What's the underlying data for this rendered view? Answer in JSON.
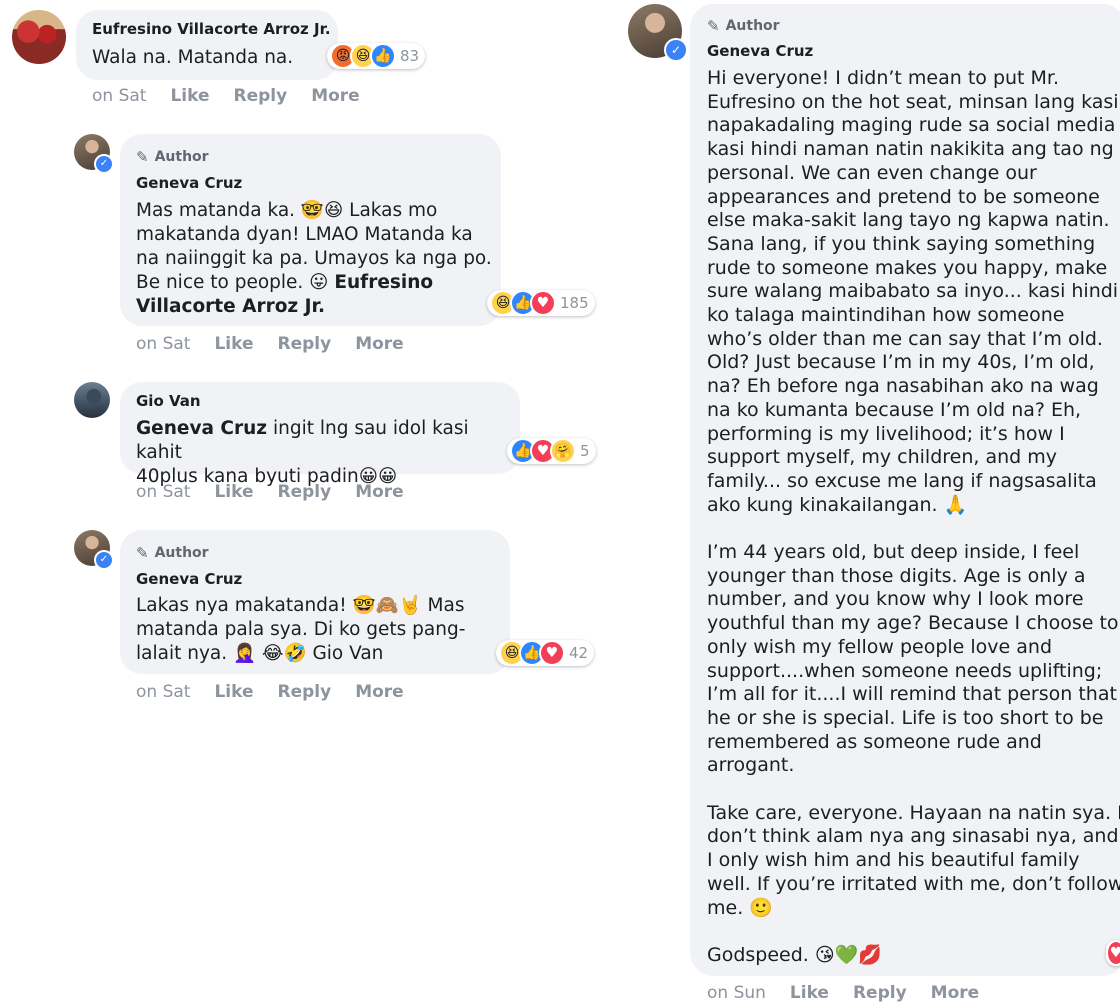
{
  "comments": [
    {
      "name": "Eufresino Villacorte Arroz Jr.",
      "text": "Wala na. Matanda na.",
      "reaction_count": "83",
      "actions": {
        "time": "on Sat",
        "like": "Like",
        "reply": "Reply",
        "more": "More"
      }
    },
    {
      "author_label": "Author",
      "name": "Geneva Cruz",
      "lines": [
        "Mas matanda ka. 🤓😆 Lakas mo",
        "makatanda dyan! LMAO Matanda ka",
        "na naiinggit ka pa. Umayos ka nga po.",
        "Be nice to people. 😛 "
      ],
      "mention_inline": "Eufresino",
      "mention_line2": "Villacorte Arroz Jr.",
      "reaction_count": "185",
      "actions": {
        "time": "on Sat",
        "like": "Like",
        "reply": "Reply",
        "more": "More"
      }
    },
    {
      "name": "Gio Van",
      "mention": "Geneva Cruz",
      "line1_rest": " ingit lng sau idol kasi kahit",
      "line2": "40plus kana byuti padin😀😀",
      "reaction_count": "5",
      "actions": {
        "time": "on Sat",
        "like": "Like",
        "reply": "Reply",
        "more": "More"
      }
    },
    {
      "author_label": "Author",
      "name": "Geneva Cruz",
      "lines": [
        "Lakas nya makatanda! 🤓🙈🤘 Mas",
        "matanda pala sya. Di ko gets pang-",
        "lalait nya. 🤦‍♀️ 😂🤣 Gio Van"
      ],
      "reaction_count": "42",
      "actions": {
        "time": "on Sat",
        "like": "Like",
        "reply": "Reply",
        "more": "More"
      }
    }
  ],
  "long_reply": {
    "author_label": "Author",
    "name": "Geneva Cruz",
    "paragraph1": [
      "Hi everyone! I didn’t mean to put Mr.",
      "Eufresino on the hot seat, minsan lang kasi",
      "napakadaling maging rude sa social media",
      "kasi hindi naman natin nakikita ang tao ng",
      "personal. We can even change our",
      "appearances and pretend to be someone",
      "else maka-sakit lang tayo ng kapwa natin.",
      "Sana lang, if you think saying something",
      "rude to someone makes you happy, make",
      "sure walang maibabato sa inyo... kasi hindi",
      "ko talaga maintindihan how someone",
      "who’s older than me can say that I’m old.",
      "Old? Just because I’m in my 40s, I’m old,",
      "na? Eh before nga nasabihan ako na wag",
      "na ko kumanta because I’m old na? Eh,",
      "performing is my livelihood; it’s how I",
      "support myself, my children, and my",
      "family... so excuse me lang if nagsasalita",
      "ako kung kinakailangan. 🙏"
    ],
    "paragraph2": [
      "I’m 44 years old, but deep inside, I feel",
      "younger than those digits. Age is only a",
      "number, and you know why I look more",
      "youthful than my age? Because I choose to",
      "only wish my fellow people love and",
      "support....when someone needs uplifting;",
      "I’m all for it....I will remind that person that",
      "he or she is special. Life is too short to be",
      "remembered as someone rude and",
      "arrogant."
    ],
    "paragraph3": [
      "Take care, everyone. Hayaan na natin sya. I",
      "don’t think alam nya ang sinasabi nya, and",
      "I only wish him and his beautiful family",
      "well. If you’re irritated with me, don’t follow",
      "me. 🙂"
    ],
    "closing": "Godspeed. 😘💚💋",
    "actions": {
      "time": "on Sun",
      "like": "Like",
      "reply": "Reply",
      "more": "More"
    }
  }
}
